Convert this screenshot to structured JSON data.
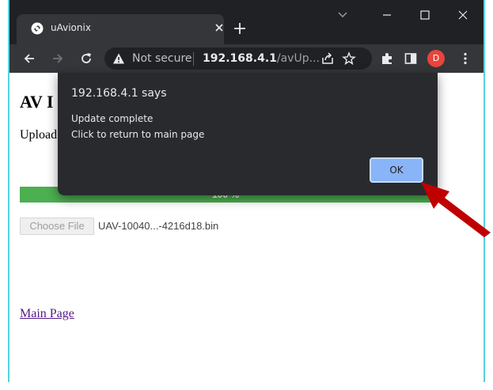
{
  "browser": {
    "tab": {
      "title": "uAvionix"
    },
    "toolbar": {
      "security_label": "Not secure",
      "url_host": "192.168.4.1",
      "url_path": "/avUp...",
      "profile_initial": "D"
    }
  },
  "page": {
    "heading": "AV I",
    "status_text": "Upload",
    "progress": {
      "value_percent": 100,
      "label": "100 %"
    },
    "file_button_label": "Choose File",
    "file_name": "UAV-10040...-4216d18.bin",
    "main_link": "Main Page"
  },
  "dialog": {
    "title": "192.168.4.1 says",
    "message_line1": "Update complete",
    "message_line2": "Click to return to main page",
    "ok_label": "OK"
  },
  "colors": {
    "frame_border": "#55d3df",
    "titlebar": "#202124",
    "toolbar": "#35363a",
    "progress_fill": "#4caf50",
    "ok_button": "#8ab4f8",
    "annotation_arrow": "#c00000"
  }
}
